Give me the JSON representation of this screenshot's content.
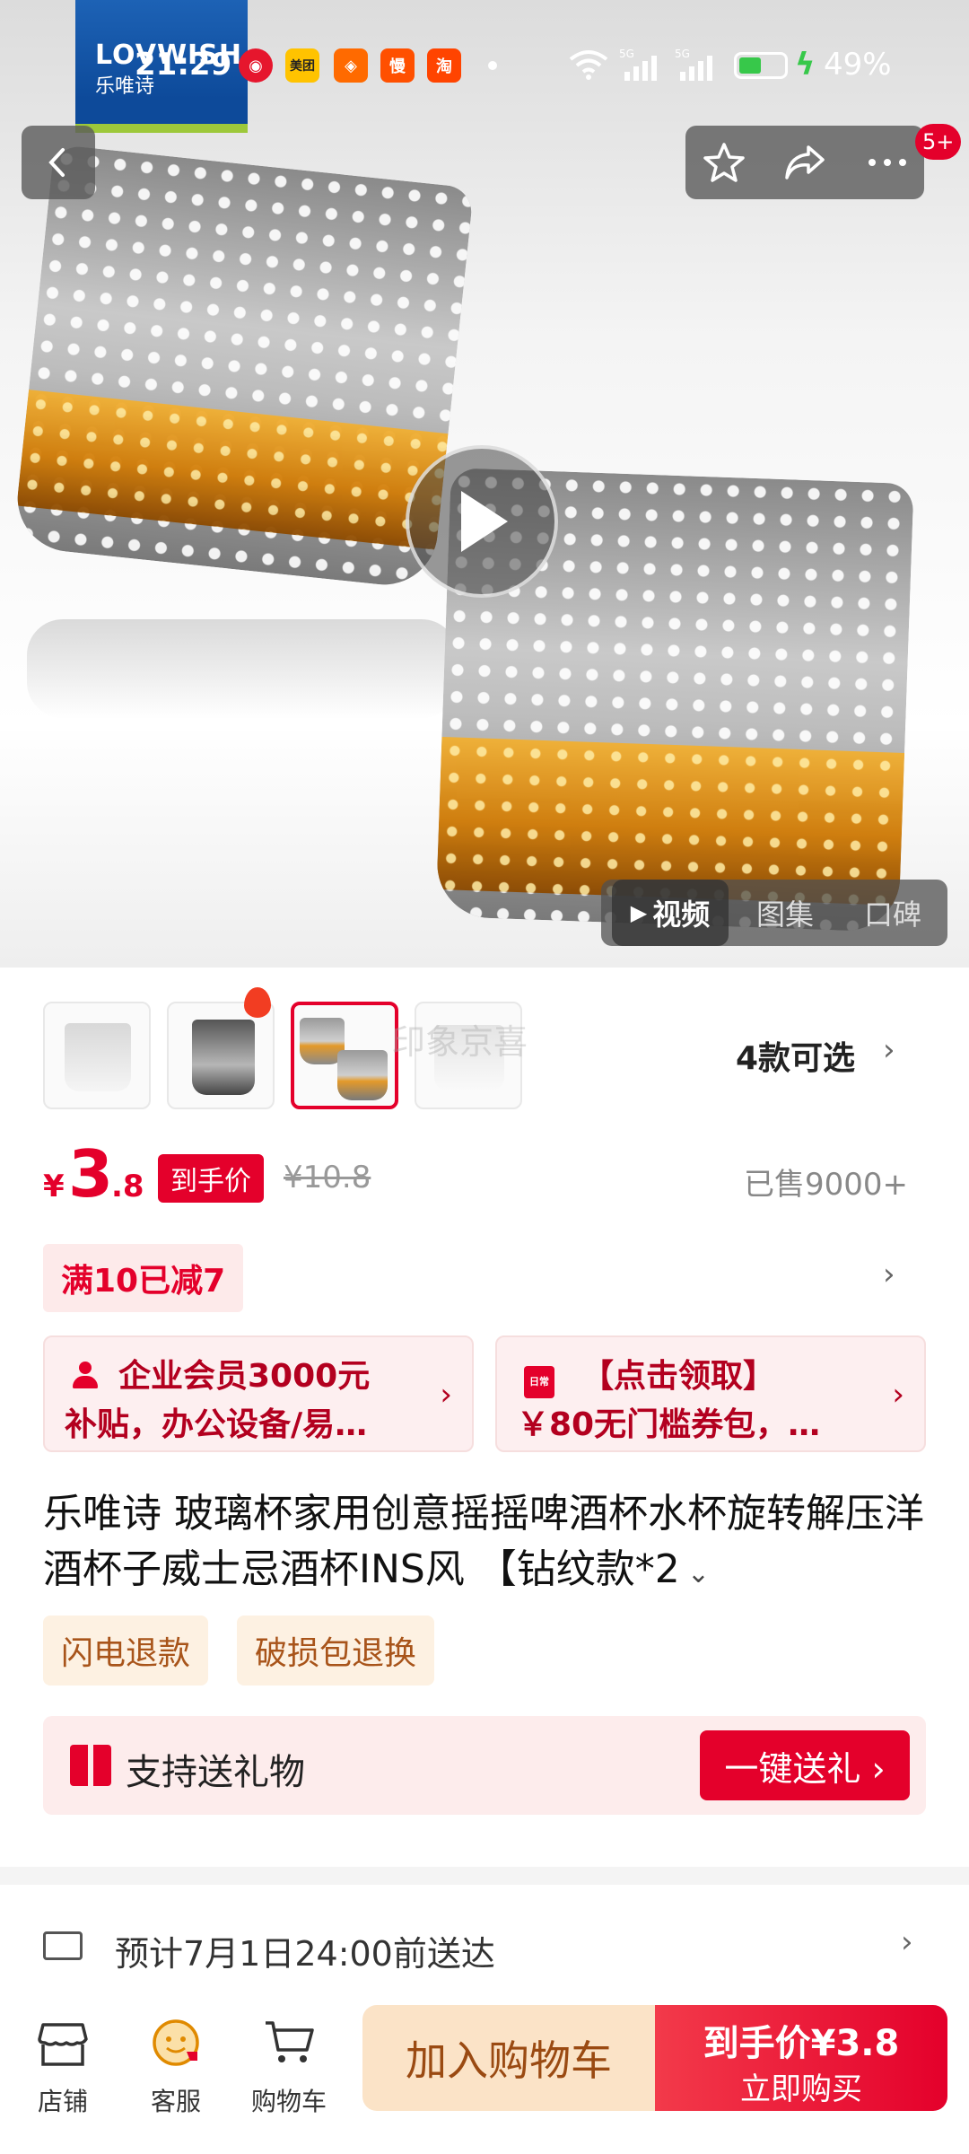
{
  "status_bar": {
    "time": "21:29",
    "app_icons": [
      "weibo-icon",
      "meituan-icon",
      "taobao-icon",
      "manman-icon",
      "tao-icon"
    ],
    "meituan_label": "美团",
    "manman_label": "慢",
    "tao_label": "淘",
    "battery": "49%",
    "battery_level": 0.49
  },
  "brand": {
    "logo_text": "LOVWISH",
    "logo_cn": "乐唯诗"
  },
  "header": {
    "cart_badge": "5+"
  },
  "media": {
    "tabs": [
      "视频",
      "图集",
      "口碑"
    ],
    "active_tab": 0
  },
  "gallery": {
    "thumb_count": 4,
    "selected_index": 2,
    "watermark": "印象京喜",
    "variants_label": "4款可选"
  },
  "price": {
    "currency": "¥",
    "integer": "3",
    "decimal": ".8",
    "tag": "到手价",
    "original": "¥10.8",
    "sold": "已售9000+"
  },
  "promo": {
    "label": "满10已减7"
  },
  "cards": [
    {
      "line1": "企业会员3000元",
      "line2": "补贴，办公设备/易…",
      "icon": "person-icon"
    },
    {
      "line1": "【点击领取】",
      "line2": "￥80无门槛券包，…",
      "icon": "coupon-icon",
      "icon_text": "日常"
    }
  ],
  "product": {
    "title": "乐唯诗 玻璃杯家用创意摇摇啤酒杯水杯旋转解压洋酒杯子威士忌酒杯INS风 【钻纹款*2"
  },
  "services": [
    "闪电退款",
    "破损包退换"
  ],
  "gift": {
    "label": "支持送礼物",
    "button": "一键送礼 ›"
  },
  "delivery": {
    "text": "预计7月1日24:00前送达"
  },
  "bottom_nav": [
    {
      "label": "店铺",
      "icon": "store-icon"
    },
    {
      "label": "客服",
      "icon": "service-icon"
    },
    {
      "label": "购物车",
      "icon": "cart-icon"
    }
  ],
  "actions": {
    "add_to_cart": "加入购物车",
    "buy_price": "到手价¥3.8",
    "buy_now": "立即购买"
  },
  "colors": {
    "accent": "#e4002b",
    "cart_bg": "#fbe3c7",
    "cart_text": "#9a4a12"
  }
}
